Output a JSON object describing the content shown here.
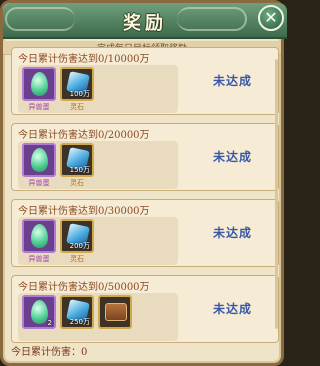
{
  "header": {
    "title": "奖励",
    "close_label": "✕"
  },
  "subtitle": "完成每日目标领取奖励",
  "tasks": [
    {
      "title": "今日累计伤害达到0/10000万",
      "status": "未达成",
      "rewards": [
        {
          "icon": "egg-icon",
          "label": "异兽蛋",
          "qty": ""
        },
        {
          "icon": "stone-icon",
          "label": "灵石",
          "qty": "100万"
        }
      ]
    },
    {
      "title": "今日累计伤害达到0/20000万",
      "status": "未达成",
      "rewards": [
        {
          "icon": "egg-icon",
          "label": "异兽蛋",
          "qty": ""
        },
        {
          "icon": "stone-icon",
          "label": "灵石",
          "qty": "150万"
        }
      ]
    },
    {
      "title": "今日累计伤害达到0/30000万",
      "status": "未达成",
      "rewards": [
        {
          "icon": "egg-icon",
          "label": "异兽蛋",
          "qty": ""
        },
        {
          "icon": "stone-icon",
          "label": "灵石",
          "qty": "200万"
        }
      ]
    },
    {
      "title": "今日累计伤害达到0/50000万",
      "status": "未达成",
      "rewards": [
        {
          "icon": "egg-icon",
          "label": "",
          "qty": "2"
        },
        {
          "icon": "stone-icon",
          "label": "",
          "qty": "250万"
        },
        {
          "icon": "chest-icon",
          "label": "",
          "qty": ""
        }
      ]
    }
  ],
  "footer": {
    "label": "今日累计伤害：0"
  }
}
